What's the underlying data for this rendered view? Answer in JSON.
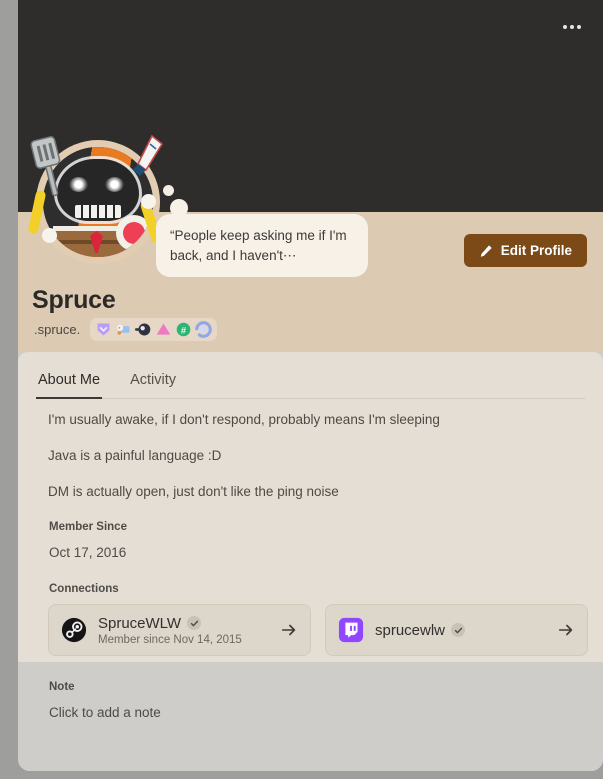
{
  "banner": {
    "menu_icon": "overflow-menu-icon",
    "background_color": "#2f2d2b"
  },
  "header": {
    "background_color": "#ddcab3",
    "avatar_icon": "avatar-skull-chef",
    "status_text": "“People keep asking me if I'm back, and I haven't⋯",
    "edit_profile_label": "Edit Profile",
    "edit_icon": "pencil-icon",
    "edit_button_color": "#7c4a16"
  },
  "identity": {
    "display_name": "Spruce",
    "handle": ".spruce.",
    "badges": [
      {
        "name": "badge-nitro-shield",
        "color": "#b89df0"
      },
      {
        "name": "badge-quest-device",
        "color": "#8fb8e8"
      },
      {
        "name": "badge-orb-dark",
        "color": "#2f3340"
      },
      {
        "name": "badge-triangle-pink",
        "color": "#f07ac2"
      },
      {
        "name": "badge-hash-green",
        "color": "#2bb673"
      },
      {
        "name": "badge-wreath-blue",
        "color": "#8fa8e8"
      }
    ]
  },
  "card": {
    "tabs": [
      {
        "label": "About Me",
        "active": true
      },
      {
        "label": "Activity",
        "active": false
      }
    ],
    "bio": [
      "I'm usually awake, if I don't respond, probably means I'm sleeping",
      "Java is a painful language :D",
      "DM is actually open, just don't like the ping noise"
    ],
    "member_since": {
      "label": "Member Since",
      "value": "Oct 17, 2016"
    },
    "connections": {
      "label": "Connections",
      "items": [
        {
          "platform_icon": "steam-icon",
          "name": "SpruceWLW",
          "verified": true,
          "subtitle": "Member since Nov 14, 2015",
          "arrow_icon": "arrow-right-icon"
        },
        {
          "platform_icon": "twitch-icon",
          "name": "sprucewlw",
          "verified": true,
          "subtitle": "",
          "arrow_icon": "arrow-right-icon"
        }
      ]
    },
    "note": {
      "label": "Note",
      "placeholder": "Click to add a note"
    }
  }
}
